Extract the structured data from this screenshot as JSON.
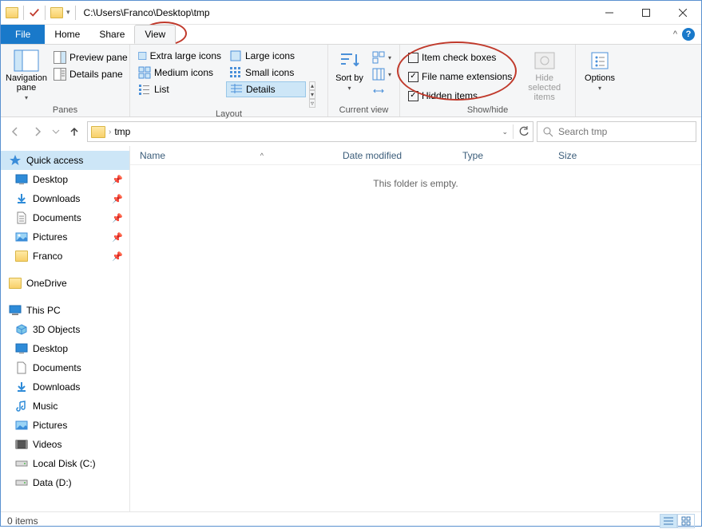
{
  "window": {
    "title": "C:\\Users\\Franco\\Desktop\\tmp"
  },
  "tabs": {
    "file": "File",
    "home": "Home",
    "share": "Share",
    "view": "View"
  },
  "ribbon": {
    "panes": {
      "navigation_pane": "Navigation pane",
      "preview_pane": "Preview pane",
      "details_pane": "Details pane",
      "group_label": "Panes"
    },
    "layout": {
      "xl_icons": "Extra large icons",
      "l_icons": "Large icons",
      "m_icons": "Medium icons",
      "s_icons": "Small icons",
      "list": "List",
      "details": "Details",
      "group_label": "Layout"
    },
    "current_view": {
      "sort_by": "Sort by",
      "group_label": "Current view"
    },
    "show_hide": {
      "item_check_boxes": "Item check boxes",
      "file_name_extensions": "File name extensions",
      "hidden_items": "Hidden items",
      "hide_selected": "Hide selected items",
      "group_label": "Show/hide"
    },
    "options": "Options"
  },
  "address": {
    "current_folder": "tmp",
    "search_placeholder": "Search tmp"
  },
  "columns": {
    "name": "Name",
    "date_modified": "Date modified",
    "type": "Type",
    "size": "Size"
  },
  "empty_message": "This folder is empty.",
  "nav": {
    "quick_access": "Quick access",
    "desktop": "Desktop",
    "downloads": "Downloads",
    "documents": "Documents",
    "pictures": "Pictures",
    "franco": "Franco",
    "onedrive": "OneDrive",
    "this_pc": "This PC",
    "objects3d": "3D Objects",
    "music": "Music",
    "videos": "Videos",
    "local_disk": "Local Disk (C:)",
    "data_d": "Data (D:)"
  },
  "status": {
    "items": "0 items"
  }
}
